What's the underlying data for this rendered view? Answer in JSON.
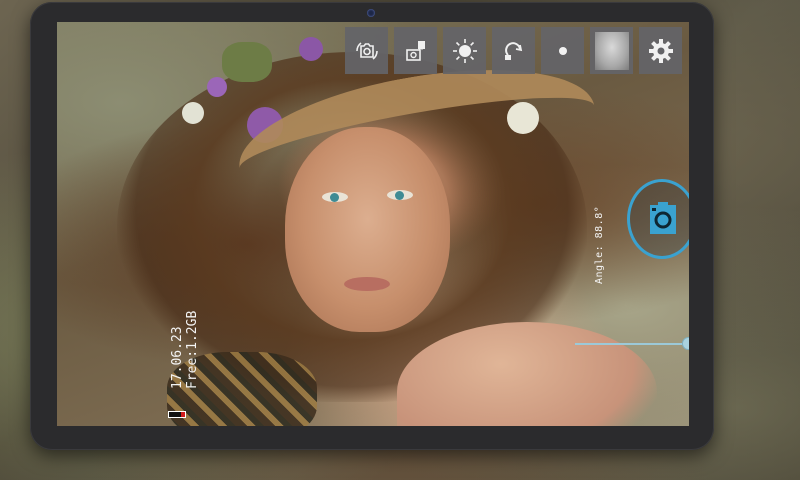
{
  "app": {
    "toolbar": [
      {
        "name": "switch-camera",
        "icon": "switch-camera-icon"
      },
      {
        "name": "flash-mode",
        "icon": "flash-auto-icon"
      },
      {
        "name": "exposure",
        "icon": "exposure-icon"
      },
      {
        "name": "timer",
        "icon": "timer-icon"
      },
      {
        "name": "dot-mode",
        "icon": "dot-icon"
      },
      {
        "name": "filter-preview",
        "icon": "filter-preview-icon"
      },
      {
        "name": "settings",
        "icon": "gear-icon"
      }
    ],
    "overlay": {
      "date": "17.06.23",
      "free_space": "Free:1.2GB",
      "angle_label": "Angle: 88.8°"
    },
    "battery": {
      "level_percent": 25,
      "level_color": "#d21b1b"
    },
    "shutter": {
      "icon": "camera-shutter-icon",
      "accent": "#3aa2d0"
    },
    "zoom": {
      "level_fraction": 1.0
    }
  }
}
